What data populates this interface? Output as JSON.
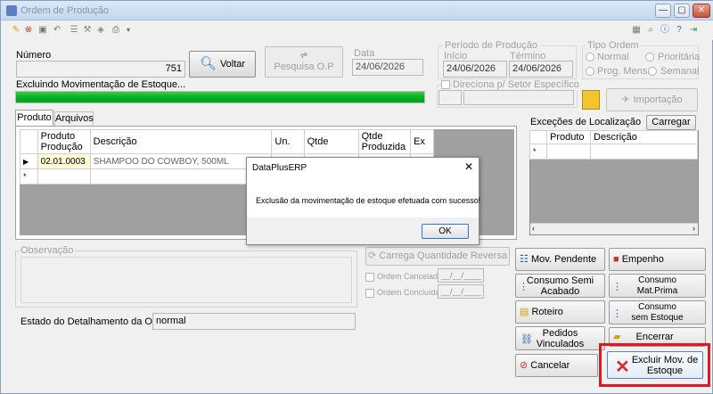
{
  "window": {
    "title": "Ordem de Produção",
    "controls": [
      "—",
      "▢",
      "✕"
    ]
  },
  "form": {
    "numero_label": "Número",
    "numero_value": "751",
    "voltar_label": "Voltar",
    "pesquisa_label": "Pesquisa O.P",
    "data_label": "Data",
    "data_value": "24/06/2026",
    "periodo_label": "Período de Produção",
    "inicio_label": "Início",
    "inicio_value": "24/06/2026",
    "termino_label": "Término",
    "termino_value": "24/06/2026",
    "tipo_label": "Tipo Ordem",
    "tipo_normal": "Normal",
    "tipo_prioritaria": "Prioritária",
    "tipo_prog_mensal": "Prog. Mensal",
    "tipo_semanal": "Semanal",
    "excluindo_label": "Excluindo Movimentação de Estoque...",
    "progress_percent": 100,
    "direciona_label": "Direciona p/ Setor Específico",
    "importacao_label": "Importação",
    "tab_produto": "Produto",
    "tab_arquivos": "Arquivos",
    "observacao_label": "Observação",
    "estado_label": "Estado do Detalhamento da OP:",
    "estado_value": "normal",
    "carrega_label": "Carrega Quantidade Reversa",
    "ordem_cancelada_label": "Ordem Cancelada",
    "ordem_concluida_label": "Ordem Concluída",
    "date_mask": "__/__/____"
  },
  "products": {
    "headers": [
      "Produto Produção",
      "Descrição",
      "Un.",
      "Qtde",
      "Qtde Produzida",
      "Ex"
    ],
    "rows": [
      {
        "code": "02.01.0003",
        "desc": "SHAMPOO DO COWBOY, 500ML"
      }
    ]
  },
  "excecoes": {
    "title": "Exceções de Localização",
    "carregar_label": "Carregar",
    "headers": [
      "Produto",
      "Descrição"
    ]
  },
  "buttons": {
    "mov_pendente": "Mov. Pendente",
    "empenho": "Empenho",
    "consumo_semi_1": "Consumo Semi",
    "consumo_semi_2": "Acabado",
    "consumo_mat_1": "Consumo",
    "consumo_mat_2": "Mat.Prima",
    "roteiro": "Roteiro",
    "consumo_sem_1": "Consumo",
    "consumo_sem_2": "sem Estoque",
    "pedidos_1": "Pedidos",
    "pedidos_2": "Vinculados",
    "encerrar": "Encerrar",
    "cancelar": "Cancelar",
    "excluir_1": "Excluir Mov. de",
    "excluir_2": "Estoque"
  },
  "dialog": {
    "title": "DataPlusERP",
    "message": "Exclusão da movimentação de estoque efetuada com sucesso!",
    "ok_label": "OK"
  },
  "colors": {
    "progress": "#06b025",
    "highlight": "#e0191d"
  }
}
